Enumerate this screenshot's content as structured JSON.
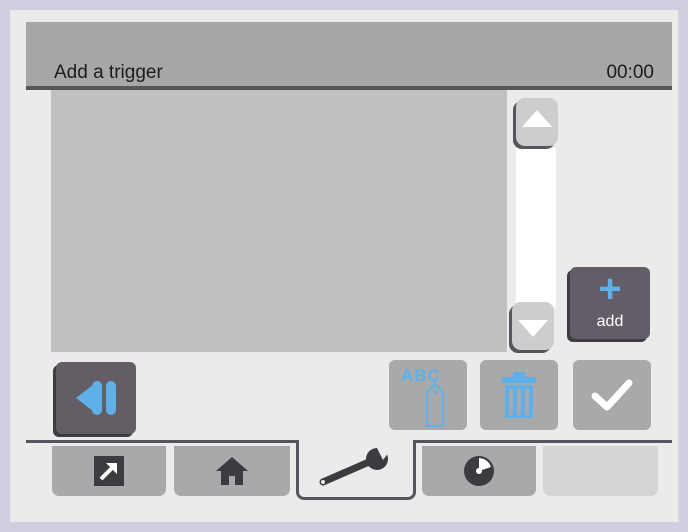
{
  "header": {
    "title": "Add a trigger",
    "clock": "00:00"
  },
  "list": {
    "items": []
  },
  "scroll": {
    "up_icon": "triangle-up-icon",
    "down_icon": "triangle-down-icon"
  },
  "buttons": {
    "add_label": "add",
    "add_icon": "plus-icon",
    "back_icon": "back-icon",
    "rename_icon": "abc-tag-icon",
    "rename_text": "ABC",
    "delete_icon": "trash-icon",
    "confirm_icon": "checkmark-icon"
  },
  "tabs": [
    {
      "icon": "share-arrow-icon",
      "active": false
    },
    {
      "icon": "home-icon",
      "active": false
    },
    {
      "icon": "wrench-icon",
      "active": true
    },
    {
      "icon": "disc-icon",
      "active": false
    },
    {
      "icon": "",
      "active": false
    }
  ],
  "colors": {
    "accent": "#5fb0e8",
    "dark": "#58555c",
    "button_gray": "#a8a9aa",
    "background": "#ecebeb"
  }
}
